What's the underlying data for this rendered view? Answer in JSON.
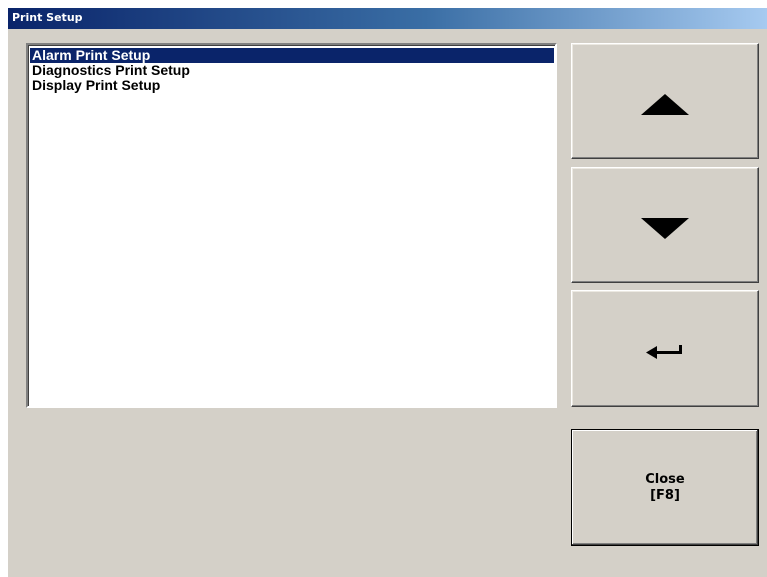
{
  "window": {
    "title": "Print Setup"
  },
  "list": {
    "items": [
      {
        "label": "Alarm Print Setup",
        "selected": true
      },
      {
        "label": "Diagnostics Print Setup",
        "selected": false
      },
      {
        "label": "Display Print Setup",
        "selected": false
      }
    ]
  },
  "buttons": {
    "up_icon": "arrow-up-icon",
    "down_icon": "arrow-down-icon",
    "enter_icon": "enter-return-icon",
    "close_label": "Close",
    "close_key": "[F8]"
  },
  "colors": {
    "selection": "#0a246a",
    "titlebar_start": "#0a246a",
    "titlebar_end": "#a6caf0",
    "face": "#d4d0c8"
  }
}
